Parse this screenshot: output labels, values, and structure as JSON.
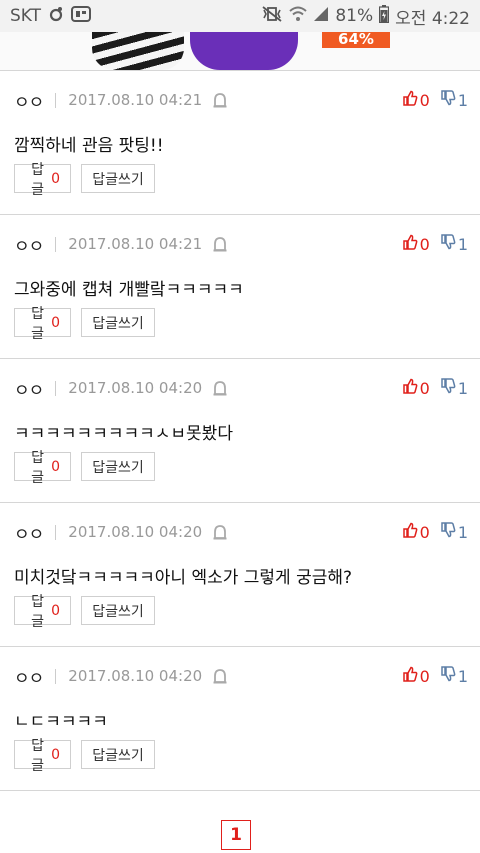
{
  "status_bar": {
    "carrier": "SKT",
    "battery": "81%",
    "time": "오전 4:22"
  },
  "banner": {
    "discount_badge": "64%"
  },
  "comments": [
    {
      "author": "ㅇㅇ",
      "date": "2017.08.10 04:21",
      "up": "0",
      "down": "1",
      "text": "깜찍하네 관음 팟팅!!",
      "reply_label": "답글",
      "reply_count": "0",
      "write_label": "답글쓰기"
    },
    {
      "author": "ㅇㅇ",
      "date": "2017.08.10 04:21",
      "up": "0",
      "down": "1",
      "text": "그와중에 캡쳐 개빨랔ㅋㅋㅋㅋㅋ",
      "reply_label": "답글",
      "reply_count": "0",
      "write_label": "답글쓰기"
    },
    {
      "author": "ㅇㅇ",
      "date": "2017.08.10 04:20",
      "up": "0",
      "down": "1",
      "text": "ㅋㅋㅋㅋㅋㅋㅋㅋㅋㅅㅂ못봤다",
      "reply_label": "답글",
      "reply_count": "0",
      "write_label": "답글쓰기"
    },
    {
      "author": "ㅇㅇ",
      "date": "2017.08.10 04:20",
      "up": "0",
      "down": "1",
      "text": "미치것닼ㅋㅋㅋㅋㅋ아니 엑소가 그렇게 궁금해?",
      "reply_label": "답글",
      "reply_count": "0",
      "write_label": "답글쓰기"
    },
    {
      "author": "ㅇㅇ",
      "date": "2017.08.10 04:20",
      "up": "0",
      "down": "1",
      "text": "ㄴㄷㅋㅋㅋㅋ",
      "reply_label": "답글",
      "reply_count": "0",
      "write_label": "답글쓰기"
    }
  ],
  "pagination": {
    "current_page": "1"
  },
  "icons": {
    "report": "siren-icon",
    "vote_up": "thumbs-up-icon",
    "vote_down": "thumbs-down-icon"
  },
  "colors": {
    "accent_red": "#e0201b",
    "down_blue": "#5d7ea6"
  }
}
